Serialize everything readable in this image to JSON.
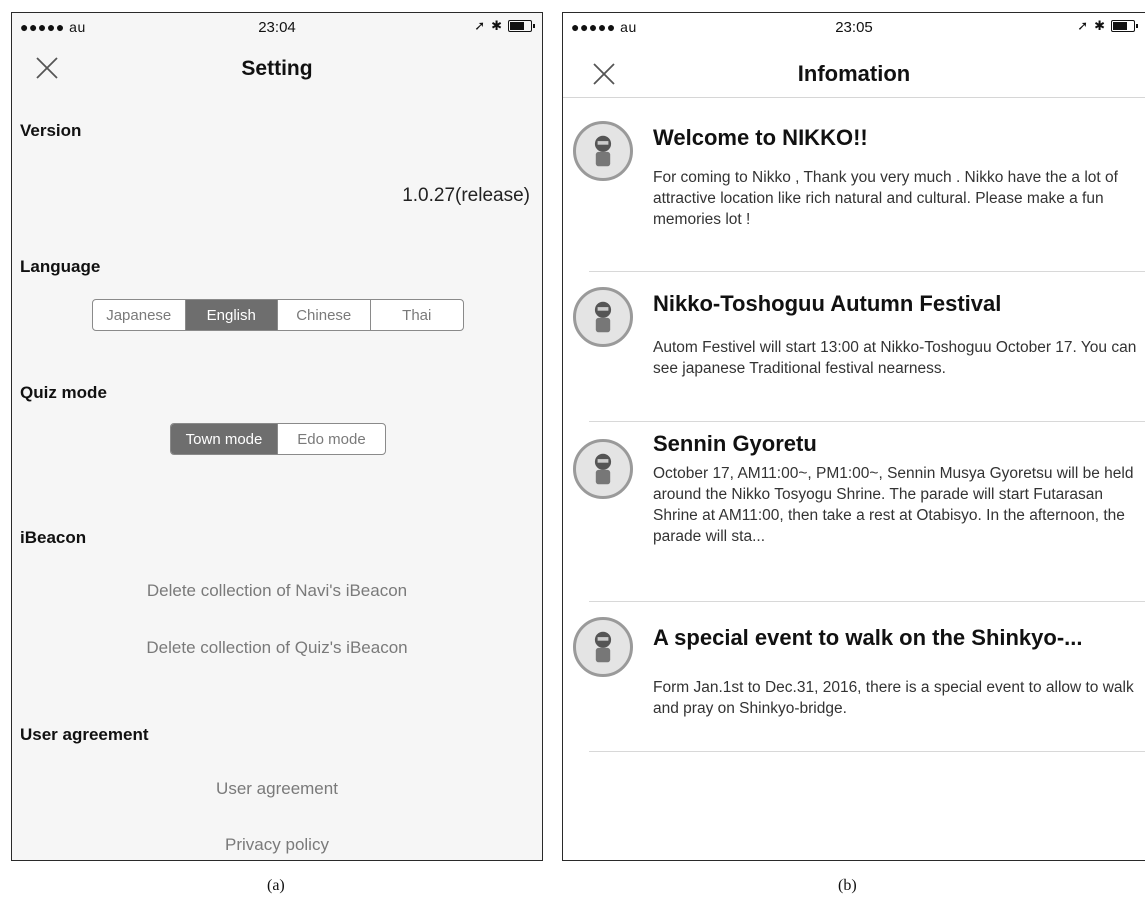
{
  "setting_screen": {
    "status": {
      "carrier": "●●●●● au",
      "time": "23:04"
    },
    "title": "Setting",
    "version": {
      "label": "Version",
      "value": "1.0.27(release)"
    },
    "language": {
      "label": "Language",
      "options": [
        "Japanese",
        "English",
        "Chinese",
        "Thai"
      ],
      "selected": "English"
    },
    "quiz_mode": {
      "label": "Quiz mode",
      "options": [
        "Town mode",
        "Edo mode"
      ],
      "selected": "Town mode"
    },
    "ibeacon": {
      "label": "iBeacon",
      "delete_navi": "Delete collection of Navi's iBeacon",
      "delete_quiz": "Delete collection of Quiz's iBeacon"
    },
    "user_agreement": {
      "label": "User agreement",
      "link": "User agreement",
      "privacy": "Privacy policy"
    }
  },
  "info_screen": {
    "status": {
      "carrier": "●●●●● au",
      "time": "23:05"
    },
    "title": "Infomation",
    "items": [
      {
        "title": "Welcome to NIKKO!!",
        "body": "For coming to Nikko , Thank you very much . Nikko have the a lot of attractive location like rich natural and cultural. Please make a fun memories lot !"
      },
      {
        "title": "Nikko-Toshoguu Autumn Festival",
        "body": "Autom Festivel will start 13:00 at Nikko-Toshoguu October 17. You can see japanese Traditional festival nearness."
      },
      {
        "title": "Sennin Gyoretu",
        "body": "October 17, AM11:00~, PM1:00~, Sennin Musya Gyoretsu will be held around the Nikko Tosyogu Shrine. The parade will start Futarasan Shrine at AM11:00, then take a rest at Otabisyo.  In the afternoon, the parade will sta..."
      },
      {
        "title": "A special event to walk on the Shinkyo-...",
        "body": "Form Jan.1st to Dec.31, 2016, there is a special event to allow to walk and pray on Shinkyo-bridge."
      }
    ]
  },
  "captions": {
    "a": "(a)",
    "b": "(b)"
  }
}
